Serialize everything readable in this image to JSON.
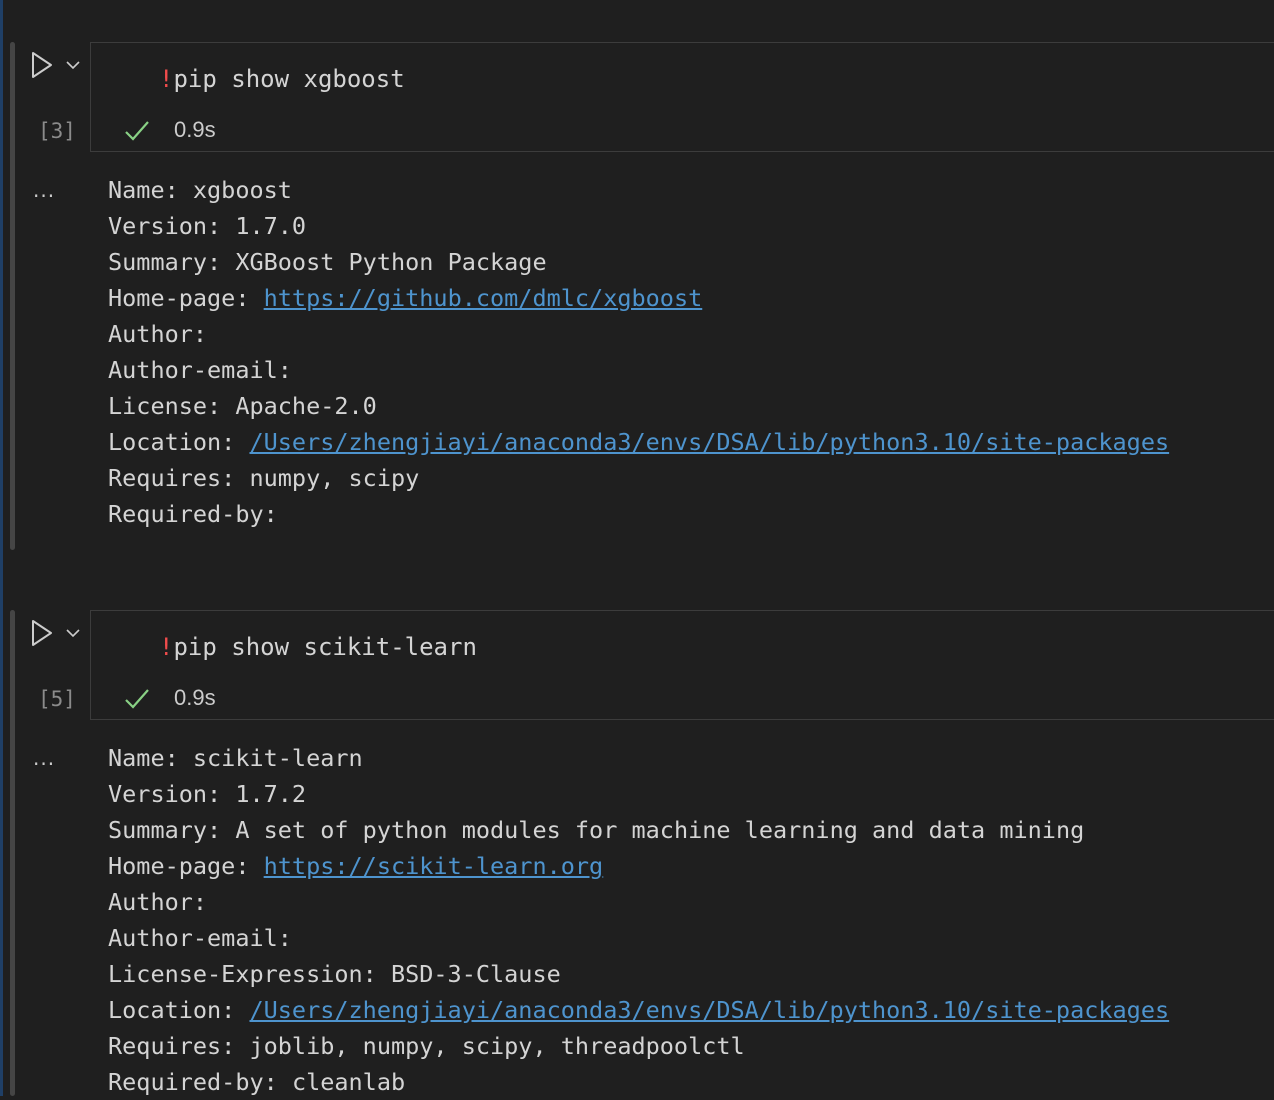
{
  "cells": [
    {
      "exec_count": "[3]",
      "code_bang": "!",
      "code_rest": "pip show xgboost",
      "status_time": "0.9s",
      "output_more": "...",
      "output": [
        {
          "label": "Name: ",
          "value": "xgboost"
        },
        {
          "label": "Version: ",
          "value": "1.7.0"
        },
        {
          "label": "Summary: ",
          "value": "XGBoost Python Package"
        },
        {
          "label": "Home-page: ",
          "link": "https://github.com/dmlc/xgboost"
        },
        {
          "label": "Author:",
          "value": ""
        },
        {
          "label": "Author-email:",
          "value": ""
        },
        {
          "label": "License: ",
          "value": "Apache-2.0"
        },
        {
          "label": "Location: ",
          "link": "/Users/zhengjiayi/anaconda3/envs/DSA/lib/python3.10/site-packages"
        },
        {
          "label": "Requires: ",
          "value": "numpy, scipy"
        },
        {
          "label": "Required-by:",
          "value": ""
        }
      ]
    },
    {
      "exec_count": "[5]",
      "code_bang": "!",
      "code_rest": "pip show scikit-learn",
      "status_time": "0.9s",
      "output_more": "...",
      "output": [
        {
          "label": "Name: ",
          "value": "scikit-learn"
        },
        {
          "label": "Version: ",
          "value": "1.7.2"
        },
        {
          "label": "Summary: ",
          "value": "A set of python modules for machine learning and data mining"
        },
        {
          "label": "Home-page: ",
          "link": "https://scikit-learn.org"
        },
        {
          "label": "Author:",
          "value": ""
        },
        {
          "label": "Author-email:",
          "value": ""
        },
        {
          "label": "License-Expression: ",
          "value": "BSD-3-Clause"
        },
        {
          "label": "Location: ",
          "link": "/Users/zhengjiayi/anaconda3/envs/DSA/lib/python3.10/site-packages"
        },
        {
          "label": "Requires: ",
          "value": "joblib, numpy, scipy, threadpoolctl"
        },
        {
          "label": "Required-by: ",
          "value": "cleanlab"
        }
      ]
    }
  ],
  "colors": {
    "background": "#1f1f1f",
    "code_text": "#d4d4d4",
    "bang": "#f14c4c",
    "link": "#4e94ce",
    "success_check": "#89d185",
    "exec_count": "#8b8b8b"
  },
  "icons": {
    "run": "play-icon",
    "run_menu": "chevron-down-icon",
    "status": "checkmark-icon"
  }
}
